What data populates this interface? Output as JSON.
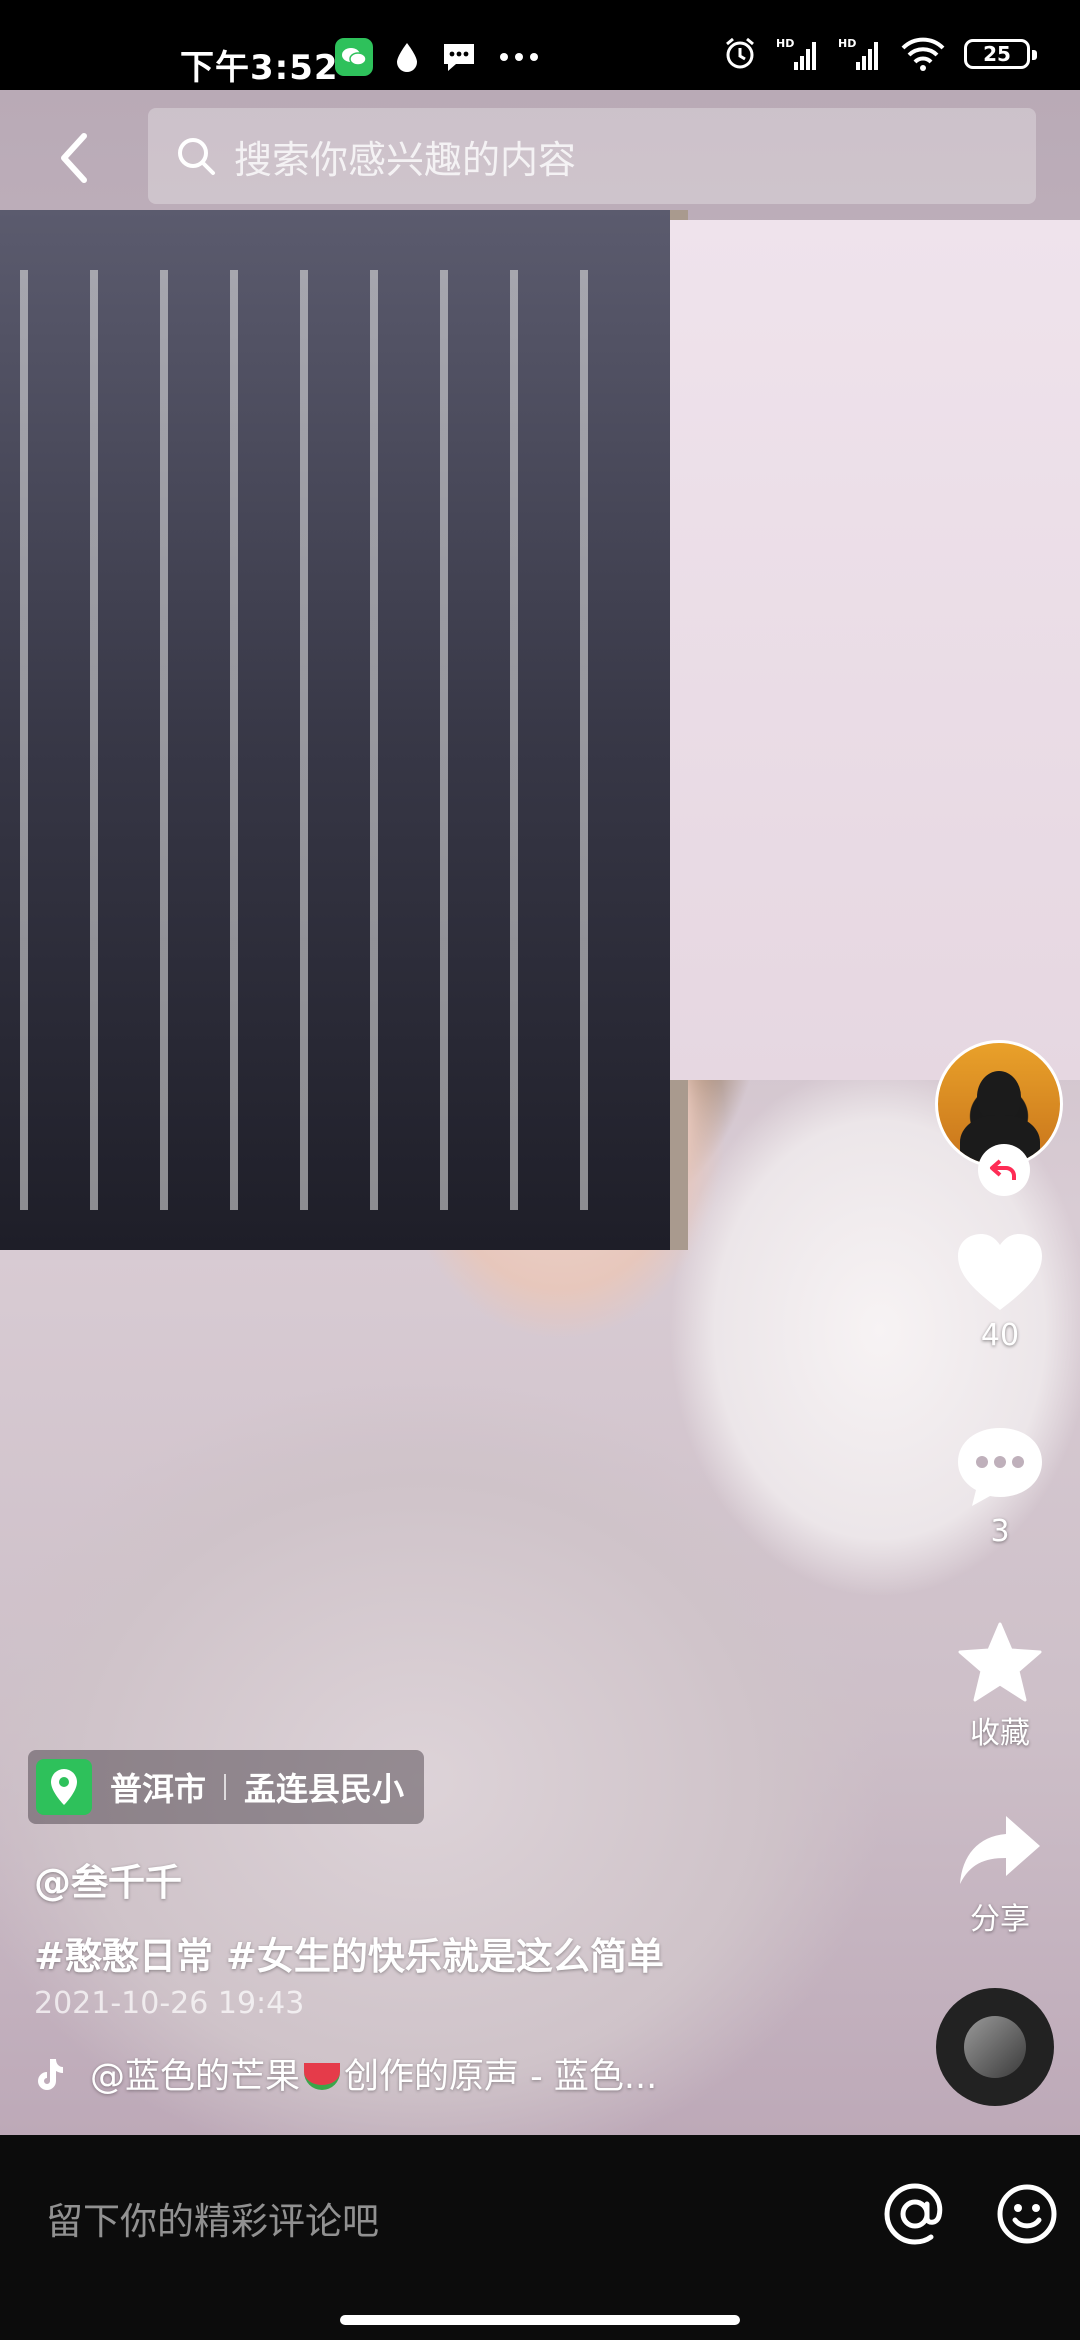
{
  "status_bar": {
    "time": "下午3:52",
    "battery": "25",
    "network_labels": [
      "HD",
      "HD"
    ]
  },
  "search": {
    "placeholder": "搜索你感兴趣的内容"
  },
  "rail": {
    "likes": "40",
    "comments": "3",
    "favorite_label": "收藏",
    "share_label": "分享"
  },
  "location": {
    "city": "普洱市",
    "place": "孟连县民小"
  },
  "post": {
    "author": "@叁千千",
    "hashtags": "#憨憨日常 #女生的快乐就是这么简单",
    "timestamp": "2021-10-26 19:43",
    "music_prefix": "@蓝色的芒果",
    "music_suffix": "创作的原声 - 蓝色..."
  },
  "comment_bar": {
    "placeholder": "留下你的精彩评论吧"
  },
  "colors": {
    "accent_red": "#fe2c55",
    "location_green": "#2ec15b",
    "wechat_green": "#2ec15b"
  },
  "icons": [
    "back-icon",
    "search-icon",
    "follow-icon",
    "heart-icon",
    "comment-icon",
    "star-icon",
    "share-icon",
    "location-pin-icon",
    "tiktok-note-icon",
    "at-icon",
    "emoji-icon"
  ]
}
